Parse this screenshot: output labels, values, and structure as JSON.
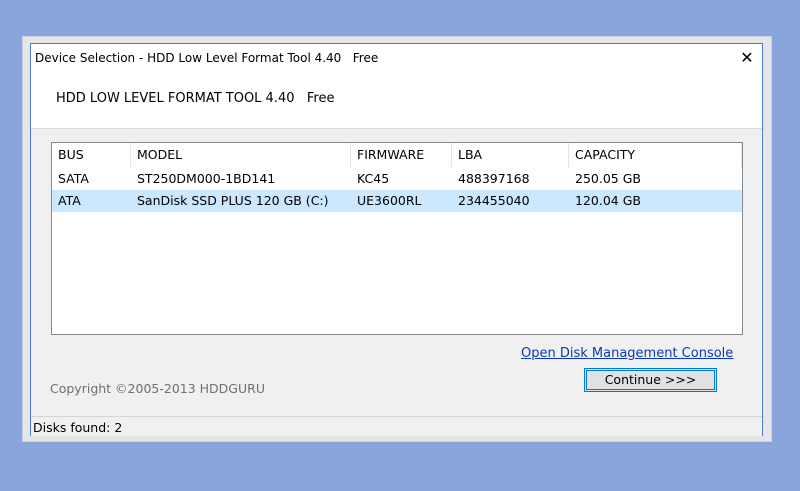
{
  "window": {
    "title": "Device Selection - HDD Low Level Format Tool 4.40   Free",
    "close_glyph": "✕"
  },
  "header": {
    "title": "HDD LOW LEVEL FORMAT TOOL 4.40   Free"
  },
  "disk_list": {
    "columns": [
      "BUS",
      "MODEL",
      "FIRMWARE",
      "LBA",
      "CAPACITY"
    ],
    "rows": [
      {
        "bus": "SATA",
        "model": "ST250DM000-1BD141",
        "firmware": "KC45",
        "lba": "488397168",
        "capacity": "250.05 GB",
        "selected": false
      },
      {
        "bus": "ATA",
        "model": "SanDisk SSD PLUS 120 GB (C:)",
        "firmware": "UE3600RL",
        "lba": "234455040",
        "capacity": "120.04 GB",
        "selected": true
      }
    ]
  },
  "links": {
    "disk_management": "Open Disk Management Console"
  },
  "footer": {
    "copyright": "Copyright ©2005-2013 HDDGURU",
    "continue_label": "Continue >>>"
  },
  "status": {
    "disks_found": "Disks found: 2"
  },
  "colors": {
    "accent": "#0078d7",
    "selection": "#cce8ff",
    "link": "#0a38b8",
    "desktop": "#8aa4dc"
  }
}
